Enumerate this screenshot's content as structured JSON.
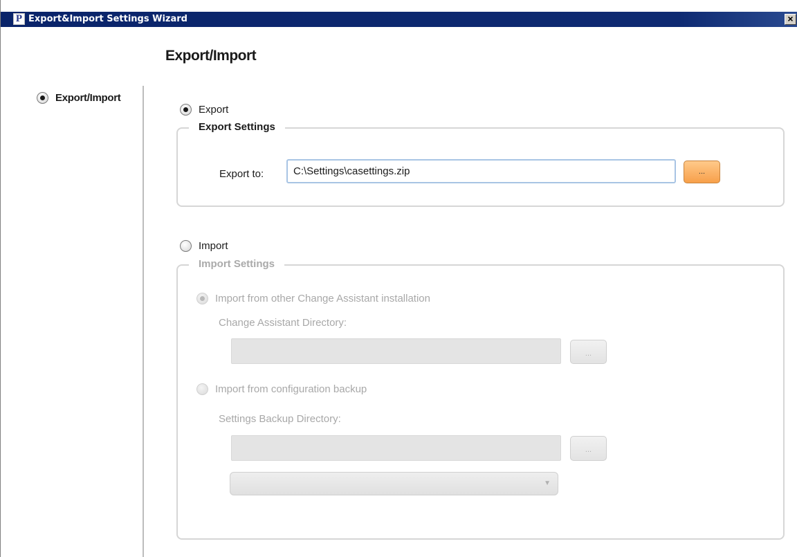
{
  "window": {
    "icon_letter": "P",
    "title": "Export&Import Settings Wizard",
    "close_glyph": "×"
  },
  "page": {
    "heading": "Export/Import"
  },
  "nav": {
    "items": [
      {
        "label": "Export/Import",
        "selected": true
      }
    ]
  },
  "export": {
    "radio_label": "Export",
    "selected": true,
    "group_title": "Export Settings",
    "field_label": "Export to:",
    "field_value": "C:\\Settings\\casettings.zip",
    "browse_label": "..."
  },
  "import": {
    "radio_label": "Import",
    "selected": false,
    "group_title": "Import Settings",
    "option_other_install": {
      "label": "Import from other Change Assistant installation",
      "selected": true,
      "enabled": false
    },
    "ca_dir_label": "Change Assistant Directory:",
    "ca_dir_value": "",
    "ca_browse_label": "...",
    "option_backup": {
      "label": "Import from configuration backup",
      "selected": false,
      "enabled": false
    },
    "backup_dir_label": "Settings Backup Directory:",
    "backup_dir_value": "",
    "backup_browse_label": "...",
    "backup_select_value": "",
    "dropdown_arrow_glyph": "▼"
  },
  "colors": {
    "titlebar": "#0a246a",
    "accent_button": "#f7a04a",
    "input_border_focus": "#a8c4e4",
    "disabled_text": "#a8a8a8"
  }
}
